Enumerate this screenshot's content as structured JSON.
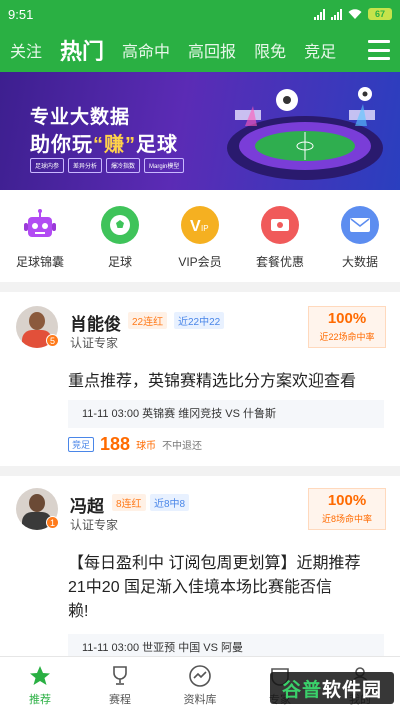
{
  "status": {
    "time": "9:51",
    "battery": "67"
  },
  "tabs": [
    {
      "label": "关注",
      "active": false
    },
    {
      "label": "热门",
      "active": true
    },
    {
      "label": "高命中",
      "active": false
    },
    {
      "label": "高回报",
      "active": false
    },
    {
      "label": "限免",
      "active": false
    },
    {
      "label": "竞足",
      "active": false
    }
  ],
  "banner": {
    "line1": "专业大数据",
    "line2_prefix": "助你玩",
    "line2_highlight": "“赚”",
    "line2_suffix": "足球",
    "chips": [
      "足球内参",
      "差异分析",
      "爆冷指数",
      "Margin模型"
    ]
  },
  "quick_menu": [
    {
      "label": "足球锦囊",
      "icon": "robot-icon",
      "color": "#b24bf3"
    },
    {
      "label": "足球",
      "icon": "soccer-ball-icon",
      "color": "#3fc35a"
    },
    {
      "label": "VIP会员",
      "icon": "vip-icon",
      "color": "#f5b021"
    },
    {
      "label": "套餐优惠",
      "icon": "ticket-icon",
      "color": "#f05a5a"
    },
    {
      "label": "大数据",
      "icon": "mail-icon",
      "color": "#5c8df0"
    }
  ],
  "posts": [
    {
      "name": "肖能俊",
      "streak": "22连红",
      "recent": "近22中22",
      "rank": "5",
      "cert": "认证专家",
      "rate": "100%",
      "rate_label": "近22场命中率",
      "title": "重点推荐，英锦赛精选比分方案欢迎查看",
      "match": "11-11 03:00  英锦赛 维冈竞技 VS 什鲁斯",
      "lottery": "竞足",
      "price": "188",
      "unit": "球币",
      "refund": "不中退还"
    },
    {
      "name": "冯超",
      "streak": "8连红",
      "recent": "近8中8",
      "rank": "1",
      "cert": "认证专家",
      "rate": "100%",
      "rate_label": "近8场命中率",
      "title_lines": [
        "【每日盈利中 订阅包周更划算】近期推荐",
        "21中20 国足渐入佳境本场比赛能否信",
        "赖!"
      ],
      "match": "11-11 03:00  世亚预 中国 VS 阿曼"
    }
  ],
  "bottom_nav": [
    {
      "label": "推荐",
      "icon": "star-icon",
      "active": true
    },
    {
      "label": "赛程",
      "icon": "trophy-icon",
      "active": false
    },
    {
      "label": "资料库",
      "icon": "chart-icon",
      "active": false
    },
    {
      "label": "专家",
      "icon": "expert-icon",
      "active": false
    },
    {
      "label": "我的",
      "icon": "user-icon",
      "active": false
    }
  ],
  "watermark": {
    "a": "谷普",
    "b": "软件园"
  },
  "colors": {
    "brand": "#2ab043",
    "accent": "#ff6a00",
    "link": "#4a86e8"
  }
}
